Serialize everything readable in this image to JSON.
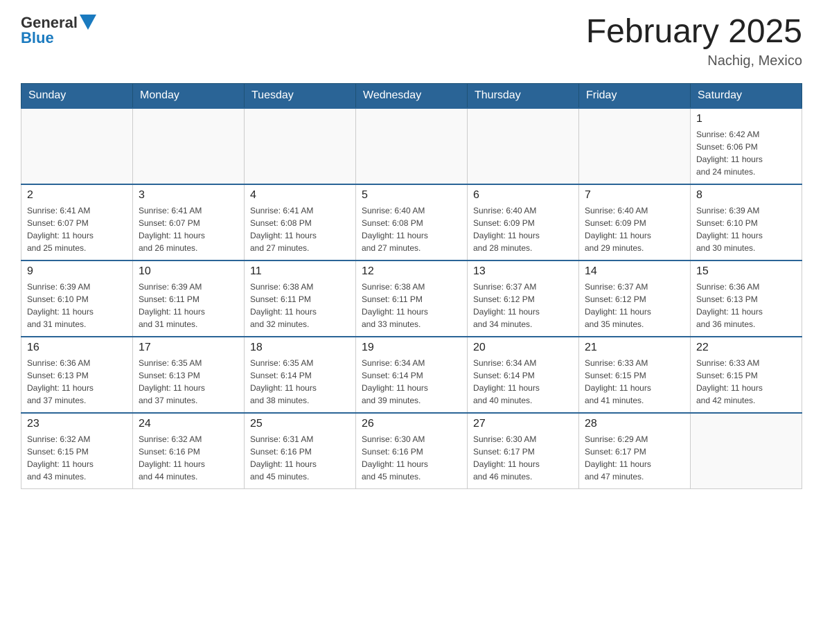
{
  "header": {
    "logo_general": "General",
    "logo_blue": "Blue",
    "month_title": "February 2025",
    "location": "Nachig, Mexico"
  },
  "days_of_week": [
    "Sunday",
    "Monday",
    "Tuesday",
    "Wednesday",
    "Thursday",
    "Friday",
    "Saturday"
  ],
  "weeks": [
    [
      {
        "day": "",
        "info": ""
      },
      {
        "day": "",
        "info": ""
      },
      {
        "day": "",
        "info": ""
      },
      {
        "day": "",
        "info": ""
      },
      {
        "day": "",
        "info": ""
      },
      {
        "day": "",
        "info": ""
      },
      {
        "day": "1",
        "info": "Sunrise: 6:42 AM\nSunset: 6:06 PM\nDaylight: 11 hours\nand 24 minutes."
      }
    ],
    [
      {
        "day": "2",
        "info": "Sunrise: 6:41 AM\nSunset: 6:07 PM\nDaylight: 11 hours\nand 25 minutes."
      },
      {
        "day": "3",
        "info": "Sunrise: 6:41 AM\nSunset: 6:07 PM\nDaylight: 11 hours\nand 26 minutes."
      },
      {
        "day": "4",
        "info": "Sunrise: 6:41 AM\nSunset: 6:08 PM\nDaylight: 11 hours\nand 27 minutes."
      },
      {
        "day": "5",
        "info": "Sunrise: 6:40 AM\nSunset: 6:08 PM\nDaylight: 11 hours\nand 27 minutes."
      },
      {
        "day": "6",
        "info": "Sunrise: 6:40 AM\nSunset: 6:09 PM\nDaylight: 11 hours\nand 28 minutes."
      },
      {
        "day": "7",
        "info": "Sunrise: 6:40 AM\nSunset: 6:09 PM\nDaylight: 11 hours\nand 29 minutes."
      },
      {
        "day": "8",
        "info": "Sunrise: 6:39 AM\nSunset: 6:10 PM\nDaylight: 11 hours\nand 30 minutes."
      }
    ],
    [
      {
        "day": "9",
        "info": "Sunrise: 6:39 AM\nSunset: 6:10 PM\nDaylight: 11 hours\nand 31 minutes."
      },
      {
        "day": "10",
        "info": "Sunrise: 6:39 AM\nSunset: 6:11 PM\nDaylight: 11 hours\nand 31 minutes."
      },
      {
        "day": "11",
        "info": "Sunrise: 6:38 AM\nSunset: 6:11 PM\nDaylight: 11 hours\nand 32 minutes."
      },
      {
        "day": "12",
        "info": "Sunrise: 6:38 AM\nSunset: 6:11 PM\nDaylight: 11 hours\nand 33 minutes."
      },
      {
        "day": "13",
        "info": "Sunrise: 6:37 AM\nSunset: 6:12 PM\nDaylight: 11 hours\nand 34 minutes."
      },
      {
        "day": "14",
        "info": "Sunrise: 6:37 AM\nSunset: 6:12 PM\nDaylight: 11 hours\nand 35 minutes."
      },
      {
        "day": "15",
        "info": "Sunrise: 6:36 AM\nSunset: 6:13 PM\nDaylight: 11 hours\nand 36 minutes."
      }
    ],
    [
      {
        "day": "16",
        "info": "Sunrise: 6:36 AM\nSunset: 6:13 PM\nDaylight: 11 hours\nand 37 minutes."
      },
      {
        "day": "17",
        "info": "Sunrise: 6:35 AM\nSunset: 6:13 PM\nDaylight: 11 hours\nand 37 minutes."
      },
      {
        "day": "18",
        "info": "Sunrise: 6:35 AM\nSunset: 6:14 PM\nDaylight: 11 hours\nand 38 minutes."
      },
      {
        "day": "19",
        "info": "Sunrise: 6:34 AM\nSunset: 6:14 PM\nDaylight: 11 hours\nand 39 minutes."
      },
      {
        "day": "20",
        "info": "Sunrise: 6:34 AM\nSunset: 6:14 PM\nDaylight: 11 hours\nand 40 minutes."
      },
      {
        "day": "21",
        "info": "Sunrise: 6:33 AM\nSunset: 6:15 PM\nDaylight: 11 hours\nand 41 minutes."
      },
      {
        "day": "22",
        "info": "Sunrise: 6:33 AM\nSunset: 6:15 PM\nDaylight: 11 hours\nand 42 minutes."
      }
    ],
    [
      {
        "day": "23",
        "info": "Sunrise: 6:32 AM\nSunset: 6:15 PM\nDaylight: 11 hours\nand 43 minutes."
      },
      {
        "day": "24",
        "info": "Sunrise: 6:32 AM\nSunset: 6:16 PM\nDaylight: 11 hours\nand 44 minutes."
      },
      {
        "day": "25",
        "info": "Sunrise: 6:31 AM\nSunset: 6:16 PM\nDaylight: 11 hours\nand 45 minutes."
      },
      {
        "day": "26",
        "info": "Sunrise: 6:30 AM\nSunset: 6:16 PM\nDaylight: 11 hours\nand 45 minutes."
      },
      {
        "day": "27",
        "info": "Sunrise: 6:30 AM\nSunset: 6:17 PM\nDaylight: 11 hours\nand 46 minutes."
      },
      {
        "day": "28",
        "info": "Sunrise: 6:29 AM\nSunset: 6:17 PM\nDaylight: 11 hours\nand 47 minutes."
      },
      {
        "day": "",
        "info": ""
      }
    ]
  ]
}
